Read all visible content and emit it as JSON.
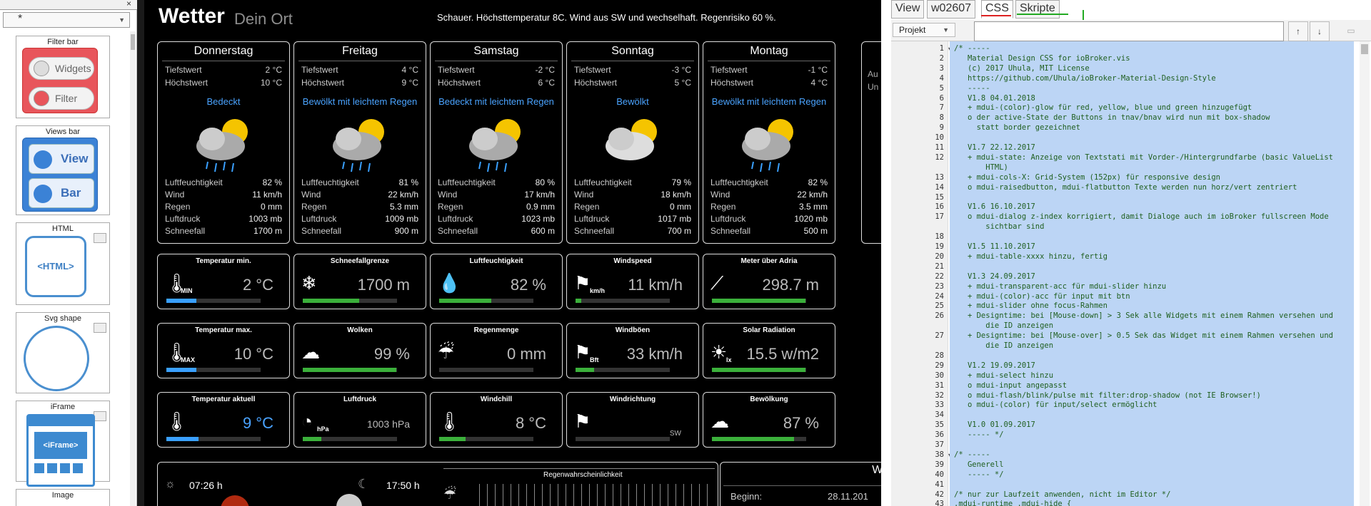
{
  "palette": {
    "panel": "#000000",
    "accent": "#4aa3ff",
    "selection": "#bcd5f5",
    "code": "#1f5f1f"
  },
  "left": {
    "close": "×",
    "select_value": "*",
    "tiles": [
      {
        "label": "Filter bar",
        "buttons": [
          "Widgets",
          "Filter"
        ]
      },
      {
        "label": "Views bar",
        "buttons": [
          "View",
          "Bar"
        ]
      },
      {
        "label": "HTML",
        "content": "<HTML>"
      },
      {
        "label": "Svg shape"
      },
      {
        "label": "iFrame",
        "content": "<iFrame>"
      },
      {
        "label": "Image"
      }
    ]
  },
  "dashboard": {
    "title": "Wetter",
    "subtitle": "Dein Ort",
    "forecast": "Schauer. Höchsttemperatur 8C. Wind aus SW und wechselhaft. Regenrisiko 60 %.",
    "days": [
      {
        "name": "Donnerstag",
        "min_label": "Tiefstwert",
        "min": "2 °C",
        "max_label": "Höchstwert",
        "max": "10 °C",
        "condition": "Bedeckt",
        "humidity": "82 %",
        "wind": "11 km/h",
        "rain": "0 mm",
        "pressure": "1003 mb",
        "snow": "1700 m"
      },
      {
        "name": "Freitag",
        "min_label": "Tiefstwert",
        "min": "4 °C",
        "max_label": "Höchstwert",
        "max": "9 °C",
        "condition": "Bewölkt mit leichtem Regen",
        "humidity": "81 %",
        "wind": "22 km/h",
        "rain": "5.3 mm",
        "pressure": "1009 mb",
        "snow": "900 m"
      },
      {
        "name": "Samstag",
        "min_label": "Tiefstwert",
        "min": "-2 °C",
        "max_label": "Höchstwert",
        "max": "6 °C",
        "condition": "Bedeckt mit leichtem Regen",
        "humidity": "80 %",
        "wind": "17 km/h",
        "rain": "0.9 mm",
        "pressure": "1023 mb",
        "snow": "600 m"
      },
      {
        "name": "Sonntag",
        "min_label": "Tiefstwert",
        "min": "-3 °C",
        "max_label": "Höchstwert",
        "max": "5 °C",
        "condition": "Bewölkt",
        "humidity": "79 %",
        "wind": "18 km/h",
        "rain": "0 mm",
        "pressure": "1017 mb",
        "snow": "700 m"
      },
      {
        "name": "Montag",
        "min_label": "Tiefstwert",
        "min": "-1 °C",
        "max_label": "Höchstwert",
        "max": "4 °C",
        "condition": "Bewölkt mit leichtem Regen",
        "humidity": "82 %",
        "wind": "22 km/h",
        "rain": "3.5 mm",
        "pressure": "1020 mb",
        "snow": "500 m"
      }
    ],
    "detail_labels": {
      "humidity": "Luftfeuchtigkeit",
      "wind": "Wind",
      "rain": "Regen",
      "pressure": "Luftdruck",
      "snow": "Schneefall"
    },
    "partial_day": {
      "line1": "Au",
      "line2": "Un"
    },
    "sensors": [
      {
        "title": "Temperatur min.",
        "value": "2 °C",
        "icon": "thermometer-min-icon",
        "glyph": "🌡",
        "tag": "MIN"
      },
      {
        "title": "Schneefallgrenze",
        "value": "1700 m",
        "icon": "snowflake-icon",
        "glyph": "❄"
      },
      {
        "title": "Luftfeuchtigkeit",
        "value": "82 %",
        "icon": "humidity-icon",
        "glyph": "💧"
      },
      {
        "title": "Windspeed",
        "value": "11 km/h",
        "icon": "windsock-icon",
        "glyph": "⚑",
        "tag": "km/h"
      },
      {
        "title": "Meter über Adria",
        "value": "298.7 m",
        "icon": "altitude-icon",
        "glyph": "⟋"
      },
      {
        "title": "Temperatur max.",
        "value": "10 °C",
        "icon": "thermometer-max-icon",
        "glyph": "🌡",
        "tag": "MAX"
      },
      {
        "title": "Wolken",
        "value": "99 %",
        "icon": "cloud-sun-icon",
        "glyph": "☁"
      },
      {
        "title": "Regenmenge",
        "value": "0 mm",
        "icon": "rain-cloud-icon",
        "glyph": "☔"
      },
      {
        "title": "Windböen",
        "value": "33 km/h",
        "icon": "windsock-bft-icon",
        "glyph": "⚑",
        "tag": "Bft"
      },
      {
        "title": "Solar Radiation",
        "value": "15.5 w/m2",
        "icon": "sun-lux-icon",
        "glyph": "☀",
        "tag": "lx"
      },
      {
        "title": "Temperatur aktuell",
        "value": "9 °C",
        "icon": "thermometer-icon",
        "glyph": "🌡"
      },
      {
        "title": "Luftdruck",
        "value": "1003 hPa",
        "icon": "barometer-icon",
        "glyph": "◔",
        "tag": "hPa"
      },
      {
        "title": "Windchill",
        "value": "8 °C",
        "icon": "windchill-icon",
        "glyph": "🌡"
      },
      {
        "title": "Windrichtung",
        "value": "",
        "sub": "SW",
        "icon": "wind-direction-icon",
        "glyph": "⚑"
      },
      {
        "title": "Bewölkung",
        "value": "87 %",
        "icon": "cloud-sun-icon",
        "glyph": "☁"
      }
    ],
    "sensor_bars": [
      0.32,
      0.6,
      0.55,
      0.06,
      0.99,
      0.32,
      0.99,
      0.0,
      0.2,
      0.99,
      0.34,
      0.2,
      0.28,
      0.0,
      0.87
    ],
    "sunrise": "07:26 h",
    "sunset": "17:50 h",
    "rain_prob_label": "Regenwahrscheinlichkeit",
    "warn_title": "We",
    "begin_label": "Beginn:",
    "begin_value": "28.11.201"
  },
  "editor": {
    "tabs": [
      "View",
      "w02607",
      "CSS",
      "Skripte"
    ],
    "project": "Projekt",
    "up": "↑",
    "down": "↓",
    "lines": [
      {
        "n": "1",
        "t": "/* -----",
        "f": true
      },
      {
        "n": "2",
        "t": "   Material Design CSS for ioBroker.vis"
      },
      {
        "n": "3",
        "t": "   (c) 2017 Uhula, MIT License"
      },
      {
        "n": "4",
        "t": "   https://github.com/Uhula/ioBroker-Material-Design-Style"
      },
      {
        "n": "5",
        "t": "   -----"
      },
      {
        "n": "6",
        "t": "   V1.8 04.01.2018"
      },
      {
        "n": "7",
        "t": "   + mdui-(color)-glow für red, yellow, blue und green hinzugefügt"
      },
      {
        "n": "8",
        "t": "   o der active-State der Buttons in tnav/bnav wird nun mit box-shadow"
      },
      {
        "n": "9",
        "t": "     statt border gezeichnet"
      },
      {
        "n": "10",
        "t": ""
      },
      {
        "n": "11",
        "t": "   V1.7 22.12.2017"
      },
      {
        "n": "12",
        "t": "   + mdui-state: Anzeige von Textstati mit Vorder-/Hintergrundfarbe (basic ValueList"
      },
      {
        "n": "",
        "t": "       HTML)"
      },
      {
        "n": "13",
        "t": "   + mdui-cols-X: Grid-System (152px) für responsive design"
      },
      {
        "n": "14",
        "t": "   o mdui-raisedbutton, mdui-flatbutton Texte werden nun horz/vert zentriert"
      },
      {
        "n": "15",
        "t": ""
      },
      {
        "n": "16",
        "t": "   V1.6 16.10.2017"
      },
      {
        "n": "17",
        "t": "   o mdui-dialog z-index korrigiert, damit Dialoge auch im ioBroker fullscreen Mode"
      },
      {
        "n": "",
        "t": "       sichtbar sind"
      },
      {
        "n": "18",
        "t": ""
      },
      {
        "n": "19",
        "t": "   V1.5 11.10.2017"
      },
      {
        "n": "20",
        "t": "   + mdui-table-xxxx hinzu, fertig"
      },
      {
        "n": "21",
        "t": ""
      },
      {
        "n": "22",
        "t": "   V1.3 24.09.2017"
      },
      {
        "n": "23",
        "t": "   + mdui-transparent-acc für mdui-slider hinzu"
      },
      {
        "n": "24",
        "t": "   + mdui-(color)-acc für input mit btn"
      },
      {
        "n": "25",
        "t": "   + mdui-slider ohne focus-Rahmen"
      },
      {
        "n": "26",
        "t": "   + Designtime: bei [Mouse-down] > 3 Sek alle Widgets mit einem Rahmen versehen und"
      },
      {
        "n": "",
        "t": "       die ID anzeigen"
      },
      {
        "n": "27",
        "t": "   + Designtime: bei [Mouse-over] > 0.5 Sek das Widget mit einem Rahmen versehen und"
      },
      {
        "n": "",
        "t": "       die ID anzeigen"
      },
      {
        "n": "28",
        "t": ""
      },
      {
        "n": "29",
        "t": "   V1.2 19.09.2017"
      },
      {
        "n": "30",
        "t": "   + mdui-select hinzu"
      },
      {
        "n": "31",
        "t": "   o mdui-input angepasst"
      },
      {
        "n": "32",
        "t": "   o mdui-flash/blink/pulse mit filter:drop-shadow (not IE Browser!)"
      },
      {
        "n": "33",
        "t": "   o mdui-(color) für input/select ermöglicht"
      },
      {
        "n": "34",
        "t": ""
      },
      {
        "n": "35",
        "t": "   V1.0 01.09.2017"
      },
      {
        "n": "36",
        "t": "   ----- */"
      },
      {
        "n": "37",
        "t": ""
      },
      {
        "n": "38",
        "t": "/* -----",
        "f": true
      },
      {
        "n": "39",
        "t": "   Generell"
      },
      {
        "n": "40",
        "t": "   ----- */"
      },
      {
        "n": "41",
        "t": ""
      },
      {
        "n": "42",
        "t": "/* nur zur Laufzeit anwenden, nicht im Editor */"
      },
      {
        "n": "43",
        "t": ".mdui-runtime .mdui-hide {"
      }
    ]
  }
}
